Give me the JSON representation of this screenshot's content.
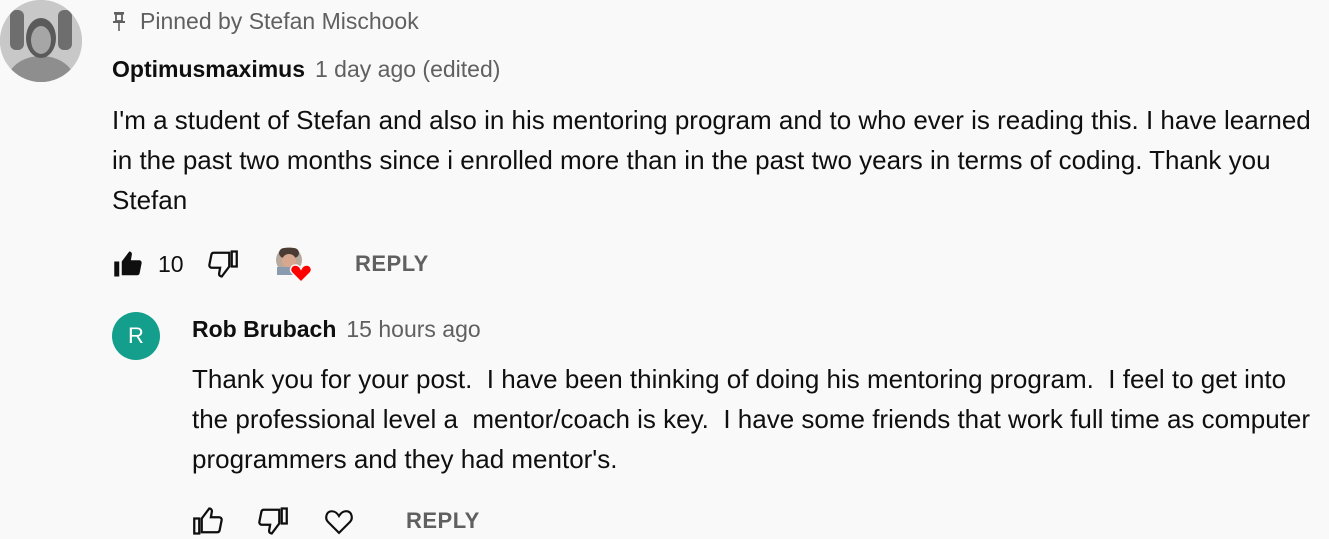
{
  "pinned": {
    "label": "Pinned by Stefan Mischook"
  },
  "comment": {
    "author": "Optimusmaximus",
    "meta": "1 day ago (edited)",
    "text": "I'm a student of Stefan and also in his mentoring program and to who ever is reading this. I have learned in the past two months since i enrolled more than in the past two years in terms of coding. Thank you Stefan",
    "likes": "10",
    "reply_label": "REPLY",
    "icons": {
      "pin": "pin-icon",
      "like": "thumbs-up-filled-icon",
      "dislike": "thumbs-down-icon",
      "creator_heart": "creator-heart-icon"
    }
  },
  "reply": {
    "avatar_letter": "R",
    "author": "Rob Brubach",
    "meta": "15 hours ago",
    "text": "Thank you for your post.  I have been thinking of doing his mentoring program.  I feel to get into the professional level a  mentor/coach is key.  I have some friends that work full time as computer programmers and they had mentor's.",
    "reply_label": "REPLY",
    "icons": {
      "like": "thumbs-up-icon",
      "dislike": "thumbs-down-icon",
      "heart": "heart-outline-icon"
    }
  },
  "colors": {
    "background": "#f9f9f9",
    "secondary_text": "#606060",
    "avatar_bg": "#139f8b",
    "heart_red": "#ff0000"
  }
}
